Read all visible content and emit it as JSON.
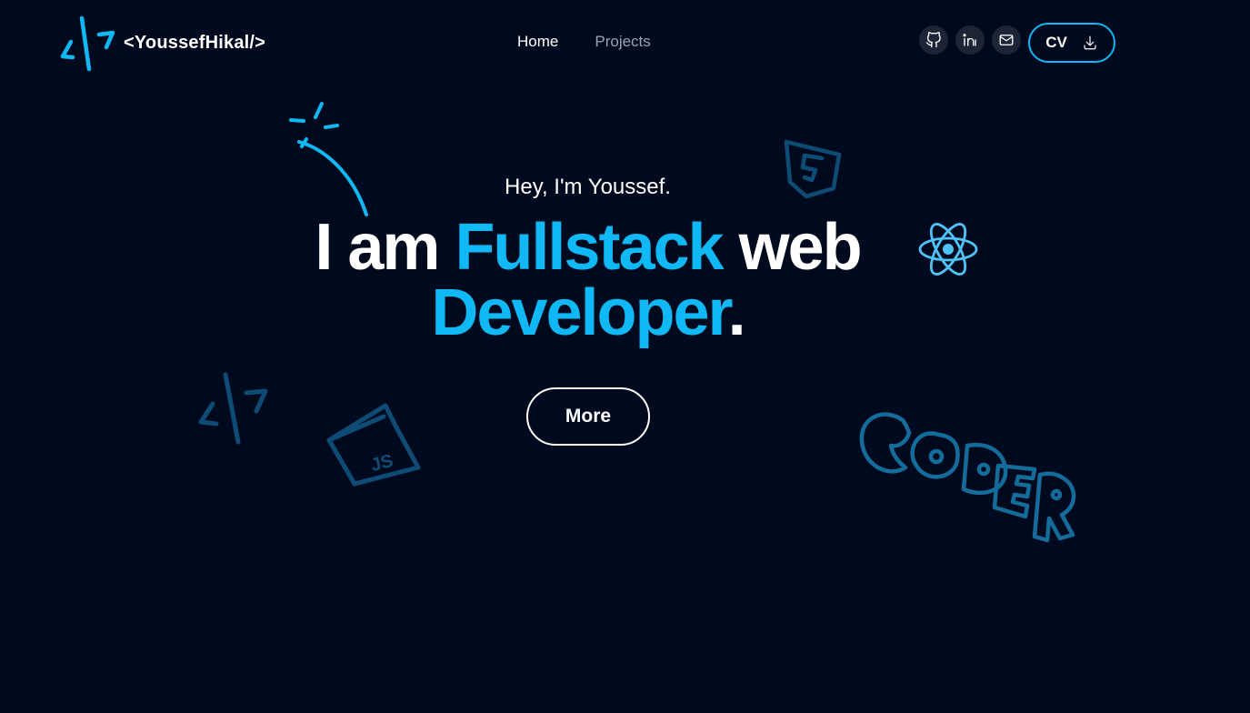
{
  "brand": {
    "name": "<YoussefHikal/>",
    "logo_icon": "code-slash-logo-icon",
    "accent_color": "#10b8f5"
  },
  "nav": {
    "home": "Home",
    "projects": "Projects"
  },
  "social": {
    "github_icon": "github-icon",
    "linkedin_icon": "linkedin-icon",
    "mail_icon": "mail-icon"
  },
  "cv": {
    "label": "CV",
    "icon": "download-icon"
  },
  "hero": {
    "greeting": "Hey, I'm Youssef.",
    "headline_part1": "I am ",
    "headline_accent1": "Fullstack",
    "headline_part2": " web",
    "headline_accent2": "Developer",
    "headline_end": ".",
    "more_label": "More"
  },
  "decorations": {
    "sparkle": "sparkle-doodle",
    "html5": "html5-doodle-icon",
    "react": "react-doodle-icon",
    "code_slash": "code-slash-doodle-icon",
    "js": "js-doodle-icon",
    "coder_text": "CODER"
  },
  "colors": {
    "background": "#000a1e",
    "accent": "#10b8f5",
    "muted_nav": "#9ba3b3",
    "doodle_dark": "#0f4c75",
    "doodle_mid": "#136c9a",
    "react_color": "#4fc3f7"
  }
}
